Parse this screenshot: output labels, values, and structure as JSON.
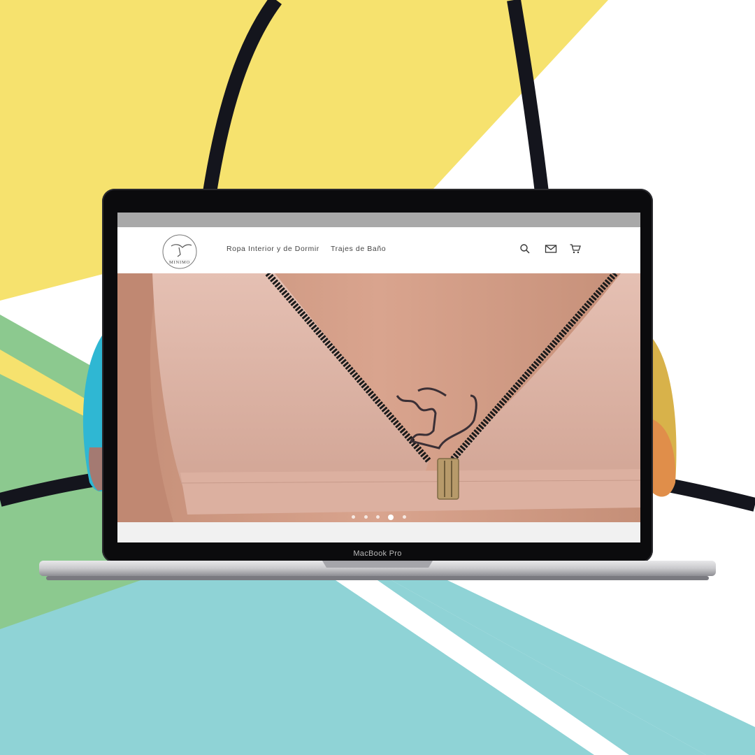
{
  "device": {
    "model_label": "MacBook Pro"
  },
  "site": {
    "logo_text": "MINIMO",
    "nav": [
      {
        "label": "Ropa Interior y de Dormir"
      },
      {
        "label": "Trajes de Baño"
      }
    ],
    "icons": [
      "search-icon",
      "mail-icon",
      "cart-icon"
    ]
  },
  "carousel": {
    "slide_count": 5,
    "active_index": 3
  },
  "colors": {
    "yellow": "#f6e26e",
    "green": "#8cc98f",
    "teal": "#8fd3d6",
    "strap": "#14151d",
    "browser_bar": "#a9a9a9"
  }
}
